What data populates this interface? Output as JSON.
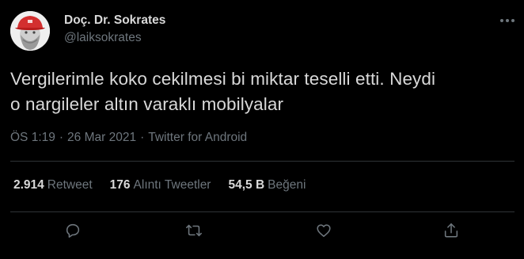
{
  "user": {
    "display_name": "Doç. Dr. Sokrates",
    "handle": "@laiksokrates",
    "avatar_icon": "avatar-portrait"
  },
  "tweet": {
    "line1": "Vergilerimle koko cekilmesi bi miktar teselli etti. Neydi",
    "line2": "o nargileler altın varaklı mobilyalar",
    "time": "ÖS 1:19",
    "separator": "·",
    "date": "26 Mar 2021",
    "source": "Twitter for Android"
  },
  "stats": {
    "retweets": {
      "num": "2.914",
      "label": "Retweet"
    },
    "quotes": {
      "num": "176",
      "label": "Alıntı Tweetler"
    },
    "likes": {
      "num": "54,5 B",
      "label": "Beğeni"
    }
  },
  "icons": {
    "more": "more-icon",
    "reply": "reply-icon",
    "retweet": "retweet-icon",
    "like": "like-icon",
    "share": "share-icon"
  },
  "colors": {
    "background": "#000000",
    "text": "#d9d9d9",
    "secondary": "#6e767d",
    "divider": "#2f3336",
    "cap_red": "#d32f2f"
  }
}
